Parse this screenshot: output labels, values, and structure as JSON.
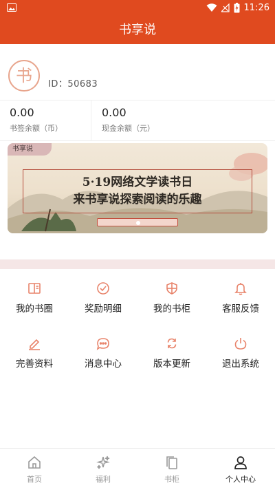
{
  "status_bar": {
    "time": "11:26"
  },
  "app_bar": {
    "title": "书享说"
  },
  "profile": {
    "avatar_char": "书",
    "id_text": "ID：50683"
  },
  "balances": [
    {
      "value": "0.00",
      "label": "书签余额（币）"
    },
    {
      "value": "0.00",
      "label": "现金余额（元）"
    }
  ],
  "banner": {
    "tag": "书享说",
    "line1": "5·19网络文学读书日",
    "line2": "来书享说探索阅读的乐趣"
  },
  "menu": [
    {
      "label": "我的书圈",
      "icon": "book-circle-icon"
    },
    {
      "label": "奖励明细",
      "icon": "reward-check-icon"
    },
    {
      "label": "我的书柜",
      "icon": "bookcase-shield-icon"
    },
    {
      "label": "客服反馈",
      "icon": "bell-icon"
    },
    {
      "label": "完善资料",
      "icon": "pen-icon"
    },
    {
      "label": "消息中心",
      "icon": "chat-bubble-icon"
    },
    {
      "label": "版本更新",
      "icon": "refresh-icon"
    },
    {
      "label": "退出系统",
      "icon": "power-icon"
    }
  ],
  "tabs": [
    {
      "label": "首页",
      "icon": "home-icon"
    },
    {
      "label": "福利",
      "icon": "sparkle-icon"
    },
    {
      "label": "书柜",
      "icon": "bookshelf-icon"
    },
    {
      "label": "个人中心",
      "icon": "person-icon",
      "active": true
    }
  ],
  "colors": {
    "brand": "#e04a1f",
    "icon_accent": "#e8836a"
  }
}
